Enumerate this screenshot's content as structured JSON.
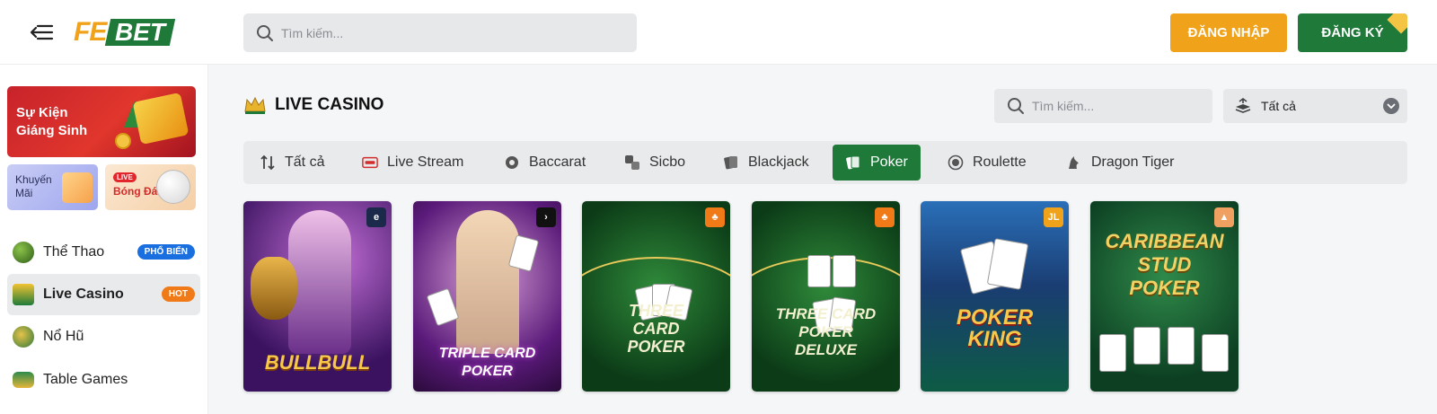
{
  "header": {
    "logo_fe": "FE",
    "logo_bet": "BET",
    "search_placeholder": "Tìm kiếm...",
    "login_label": "ĐĂNG NHẬP",
    "register_label": "ĐĂNG KÝ"
  },
  "sidebar": {
    "promo_main": "Sự Kiện Giáng Sinh",
    "promo_km": "Khuyến Mãi",
    "promo_bd_tag": "LIVE",
    "promo_bd": "Bóng Đá",
    "items": [
      {
        "label": "Thể Thao",
        "badge": "PHỔ BIẾN"
      },
      {
        "label": "Live Casino",
        "badge": "HOT"
      },
      {
        "label": "Nổ Hũ",
        "badge": ""
      },
      {
        "label": "Table Games",
        "badge": ""
      }
    ]
  },
  "main": {
    "title": "LIVE CASINO",
    "search_placeholder": "Tìm kiếm...",
    "provider_selected": "Tất cả",
    "tabs": [
      {
        "label": "Tất cả"
      },
      {
        "label": "Live Stream"
      },
      {
        "label": "Baccarat"
      },
      {
        "label": "Sicbo"
      },
      {
        "label": "Blackjack"
      },
      {
        "label": "Poker"
      },
      {
        "label": "Roulette"
      },
      {
        "label": "Dragon Tiger"
      }
    ],
    "active_tab": "Poker",
    "games": [
      {
        "title": "BULLBULL",
        "provider": "e",
        "provider_color": "#1b2a4a"
      },
      {
        "title": "TRIPLE CARD POKER",
        "provider": "›",
        "provider_color": "#111111"
      },
      {
        "title": "THREE CARD POKER",
        "provider": "♣",
        "provider_color": "#f07a18"
      },
      {
        "title": "THREE CARD POKER DELUXE",
        "provider": "♣",
        "provider_color": "#f07a18"
      },
      {
        "title": "POKER KING",
        "provider": "JL",
        "provider_color": "#f0a21a"
      },
      {
        "title": "CARIBBEAN STUD POKER",
        "provider": "▲",
        "provider_color": "#f0a060"
      }
    ]
  },
  "colors": {
    "brand_green": "#1f7a3a",
    "brand_orange": "#f0a21a"
  }
}
